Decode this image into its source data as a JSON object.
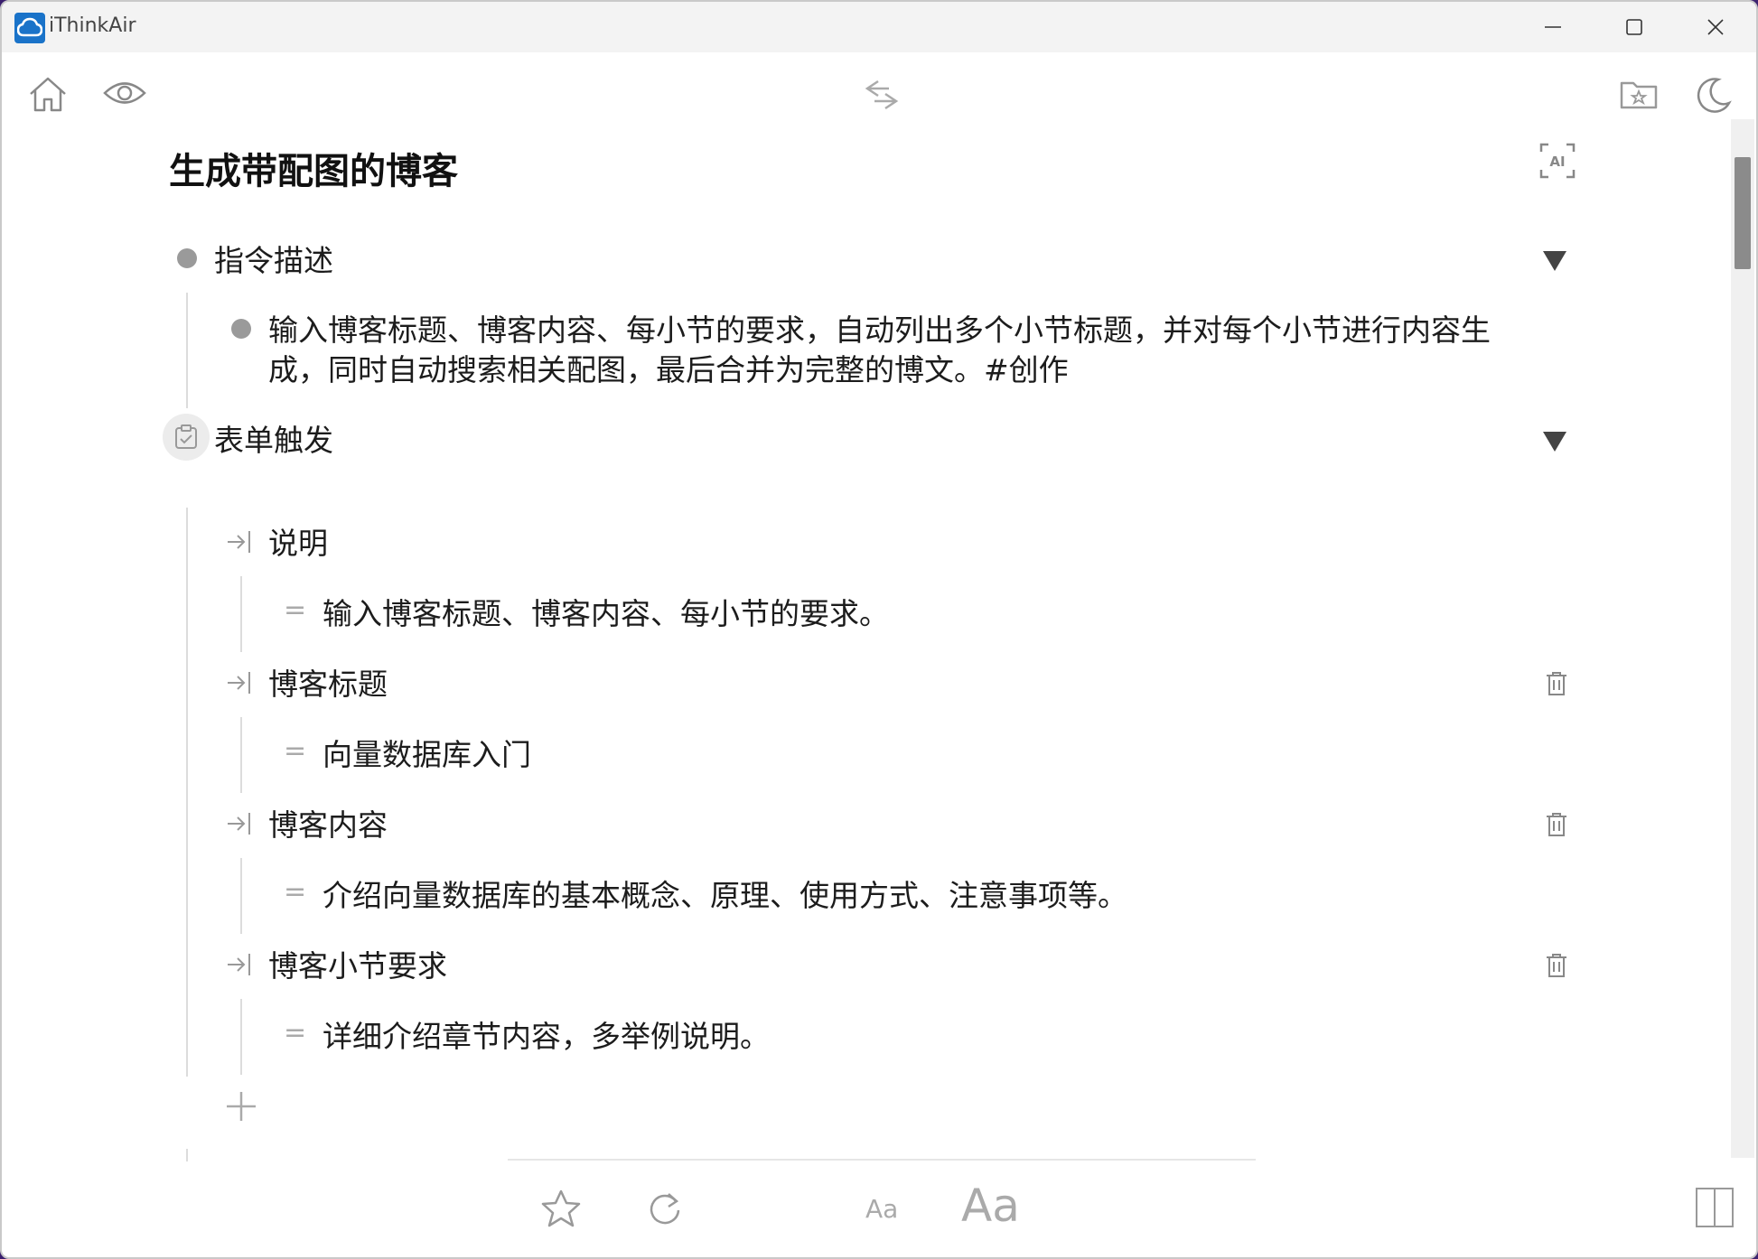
{
  "window": {
    "app_title": "iThinkAir"
  },
  "toolbar": {
    "left_icons": [
      "home-icon",
      "eye-icon"
    ],
    "center_icon": "swap-arrows-icon",
    "right_icons": [
      "folder-star-icon",
      "moon-icon"
    ]
  },
  "document": {
    "title": "生成带配图的博客",
    "ai_button_label": "AI",
    "sections": [
      {
        "heading": "指令描述",
        "children": [
          {
            "text_line1": "输入博客标题、博客内容、每小节的要求，自动列出多个小节标题，并对每个小节进行内容生",
            "text_line2": "成，同时自动搜索相关配图，最后合并为完整的博文。#创作"
          }
        ]
      },
      {
        "heading": "表单触发",
        "fields": [
          {
            "label": "说明",
            "value": "输入博客标题、博客内容、每小节的要求。"
          },
          {
            "label": "博客标题",
            "value": "向量数据库入门"
          },
          {
            "label": "博客内容",
            "value": "介绍向量数据库的基本概念、原理、使用方式、注意事项等。"
          },
          {
            "label": "博客小节要求",
            "value": "详细介绍章节内容，多举例说明。"
          }
        ]
      }
    ]
  },
  "bottom_bar": {
    "font_small_label": "Aa",
    "font_large_label": "Aa",
    "icons": [
      "star-icon",
      "refresh-icon",
      "split-view-icon"
    ]
  }
}
